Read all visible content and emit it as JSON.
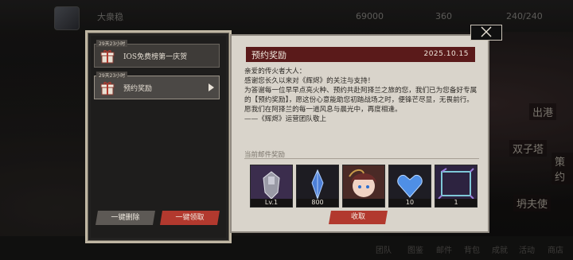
{
  "background": {
    "top_name": "大衆稳",
    "top_numbers": [
      "69000",
      "360",
      "240/240"
    ],
    "right_tags": [
      "出港",
      "双子塔",
      "策约",
      "坍夫使"
    ],
    "bottom_items": [
      "团队",
      "图鉴",
      "邮件",
      "背包",
      "成就",
      "活动",
      "商店"
    ]
  },
  "mail_list": {
    "items": [
      {
        "tag": "29天23小时",
        "title": "IOS免费榜第一庆贺",
        "icon": "gift-icon",
        "active": false
      },
      {
        "tag": "29天23小时",
        "title": "预约奖励",
        "icon": "gift-icon",
        "active": true
      }
    ],
    "delete_all_label": "一键删除",
    "claim_all_label": "一键领取"
  },
  "mail_detail": {
    "title": "预约奖励",
    "date": "2025.10.15",
    "body": [
      "亲爱的传火者大人：",
      "感谢您长久以来对《辉烬》的关注与支持！",
      "为答谢每一位早早点亮火种、预约共赴阿择兰之旅的您，我们已为您备好专属的【预约奖励】，愿这份心意能助您初踏战场之时，便锋芒尽显，无畏前行。",
      "愿我们在阿择兰的每一道风息与晨光中，再度相逢。",
      "——《辉烬》运营团队敬上"
    ],
    "rewards_label": "当前邮件奖励",
    "rewards": [
      {
        "name": "armor-figure-icon",
        "count": "Lv.1"
      },
      {
        "name": "blue-crystal-icon",
        "count": "800"
      },
      {
        "name": "character-portrait-icon",
        "count": ""
      },
      {
        "name": "blue-heart-icon",
        "count": "10"
      },
      {
        "name": "avatar-frame-icon",
        "count": "1"
      }
    ],
    "claim_label": "收取"
  },
  "colors": {
    "accent_red": "#b2392e",
    "header_dark_red": "#5a1a1a",
    "panel_paper": "#d9d4cb",
    "panel_dark": "#232221"
  }
}
